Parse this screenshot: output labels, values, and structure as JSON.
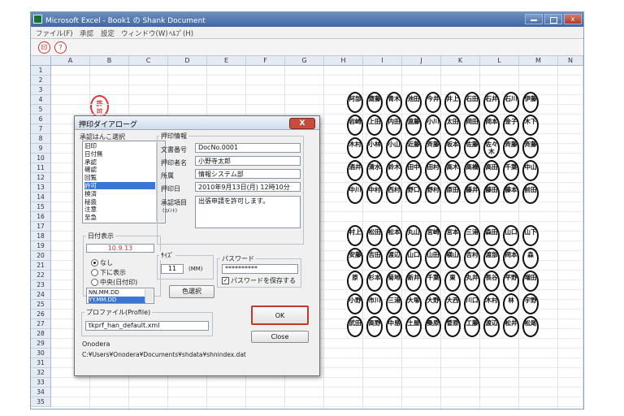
{
  "window": {
    "title": "Microsoft Excel - Book1 の Shank Document",
    "menu": [
      "ファイル(F)",
      "承認",
      "設定",
      "ウィンドウ(W)",
      "ﾍﾙﾌﾟ(H)"
    ]
  },
  "sheet": {
    "columns": [
      "A",
      "B",
      "C",
      "D",
      "E",
      "F",
      "G",
      "H",
      "I",
      "J",
      "K",
      "L",
      "M",
      "N"
    ],
    "rows": [
      "1",
      "2",
      "3",
      "4",
      "5",
      "6",
      "7",
      "8",
      "9",
      "10",
      "11",
      "12",
      "13",
      "14",
      "15",
      "16",
      "17",
      "18",
      "19",
      "20",
      "21",
      "22",
      "23",
      "24",
      "25",
      "26",
      "27",
      "28",
      "29",
      "30",
      "31",
      "32",
      "33",
      "34",
      "35"
    ],
    "red_stamp": [
      "許",
      "可"
    ],
    "stamps_top": [
      [
        "阿部",
        "齋藤",
        "青木",
        "池田",
        "今井",
        "井上",
        "石田",
        "石井",
        "石川",
        "伊藤"
      ],
      [
        "岩崎",
        "上田",
        "内田",
        "遠藤",
        "小川",
        "太田",
        "岡田",
        "岡本",
        "金子",
        "木下"
      ],
      [
        "木村",
        "小林",
        "小山",
        "近藤",
        "斉藤",
        "坂本",
        "佐藤",
        "佐々木",
        "斉藤",
        "斉藤"
      ],
      [
        "酒井",
        "清水",
        "鈴木",
        "田中",
        "田村",
        "高木",
        "高橋",
        "高田",
        "千葉",
        "中山"
      ],
      [
        "中川",
        "中村",
        "西村",
        "野口",
        "野村",
        "原田",
        "藤井",
        "藤田",
        "藤本",
        "前田"
      ]
    ],
    "stamps_bottom": [
      [
        "村上",
        "松田",
        "松本",
        "丸山",
        "宮崎",
        "宮本",
        "三浦",
        "森田",
        "山口",
        "山下"
      ],
      [
        "安藤",
        "吉田",
        "渡辺",
        "山口",
        "山田",
        "横山",
        "吉村",
        "渡部",
        "岡本",
        "森"
      ],
      [
        "原",
        "杉本",
        "菊地",
        "新井",
        "千葉",
        "東",
        "丸井",
        "長谷",
        "平野",
        "増田"
      ],
      [
        "小野",
        "市川",
        "三浦",
        "大塚",
        "大野",
        "大西",
        "川口",
        "木村",
        "林",
        "宇野"
      ],
      [
        "武田",
        "高野",
        "中島",
        "土屋",
        "桑原",
        "菅原",
        "工藤",
        "渡辺",
        "松井",
        "松尾"
      ]
    ]
  },
  "dialog": {
    "title": "押印ダイアローグ",
    "close_label": "X",
    "list_group_label": "承認はんこ選択",
    "list_items": [
      "旧印",
      "日付無",
      "承認",
      "確認",
      "回覧",
      "許可",
      "検済",
      "秘扱",
      "注意",
      "至急"
    ],
    "selected_index": 5,
    "date_group_label": "日付表示",
    "date_value": "10.9.13",
    "date_options": [
      "なし",
      "下に表示",
      "中央(日付印)"
    ],
    "date_selected": 0,
    "date_formats": [
      "NN.MM.DD",
      "YY.MM.DD"
    ],
    "date_format_selected": 1,
    "info_group_label": "押印情報",
    "fields": [
      {
        "label": "文書番号",
        "value": "DocNo.0001"
      },
      {
        "label": "押印者名",
        "value": "小野寺太郎"
      },
      {
        "label": "所属",
        "value": "情報システム部"
      },
      {
        "label": "押印日",
        "value": "2010年9月13日(月) 12時10分"
      }
    ],
    "remark_label": "承認項目",
    "remark_sub": "(ｺﾒﾝﾄ)",
    "remark_value": "出張申請を許可します。",
    "size_label": "ｻｲｽﾞ",
    "size_value": "11",
    "size_unit": "(MM)",
    "password_label": "パスワード",
    "password_value": "**********",
    "save_password_label": "パスワードを保存する",
    "save_password_checked": true,
    "color_button": "色選択",
    "ok_button": "OK",
    "close_button": "Close",
    "profile_label": "プロファイル(Profile)",
    "profile_value": "tkprf_han_default.xml",
    "user_name": "Onodera",
    "path": "C:¥Users¥Onodera¥Documents¥shdata¥shnindex.dat"
  }
}
